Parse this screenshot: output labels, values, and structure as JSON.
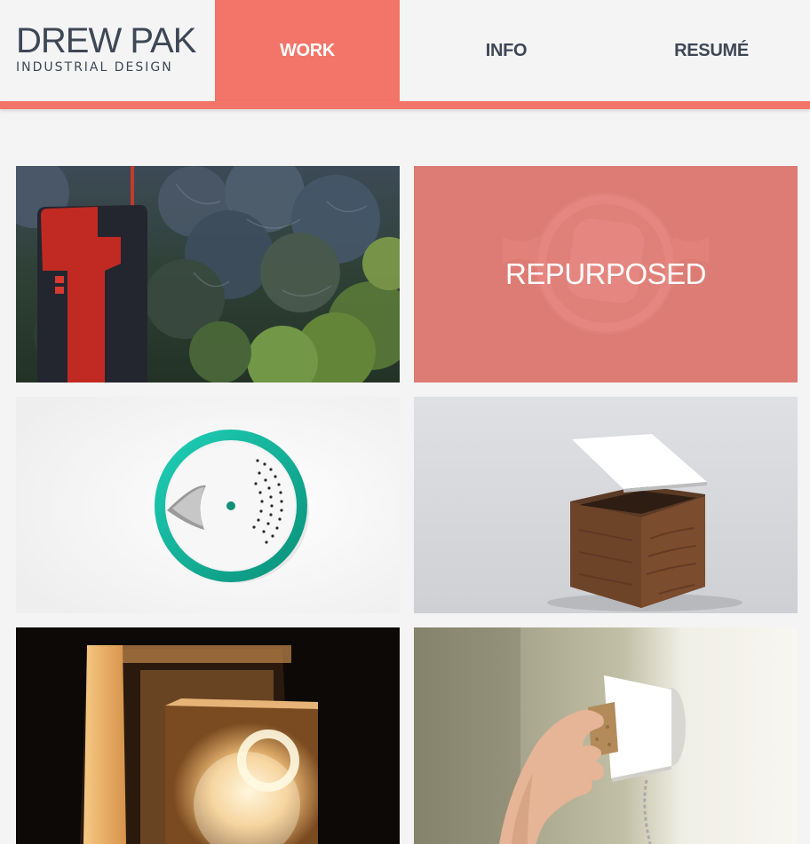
{
  "header": {
    "logo_name": "DREW PAK",
    "logo_subtitle": "INDUSTRIAL DESIGN",
    "nav": [
      {
        "label": "WORK",
        "active": true
      },
      {
        "label": "INFO",
        "active": false
      },
      {
        "label": "RESUMÉ",
        "active": false
      }
    ]
  },
  "colors": {
    "accent": "#f37468",
    "text": "#3e4756",
    "background": "#f4f4f4"
  },
  "projects": [
    {
      "image": "red-device-in-kale-garden"
    },
    {
      "image": "glass-bulb",
      "hover_title": "REPURPOSED"
    },
    {
      "image": "teal-round-speaker"
    },
    {
      "image": "wooden-box-white-lid"
    },
    {
      "image": "glowing-lamp-cubes"
    },
    {
      "image": "hand-cork-wall-fixture"
    }
  ]
}
